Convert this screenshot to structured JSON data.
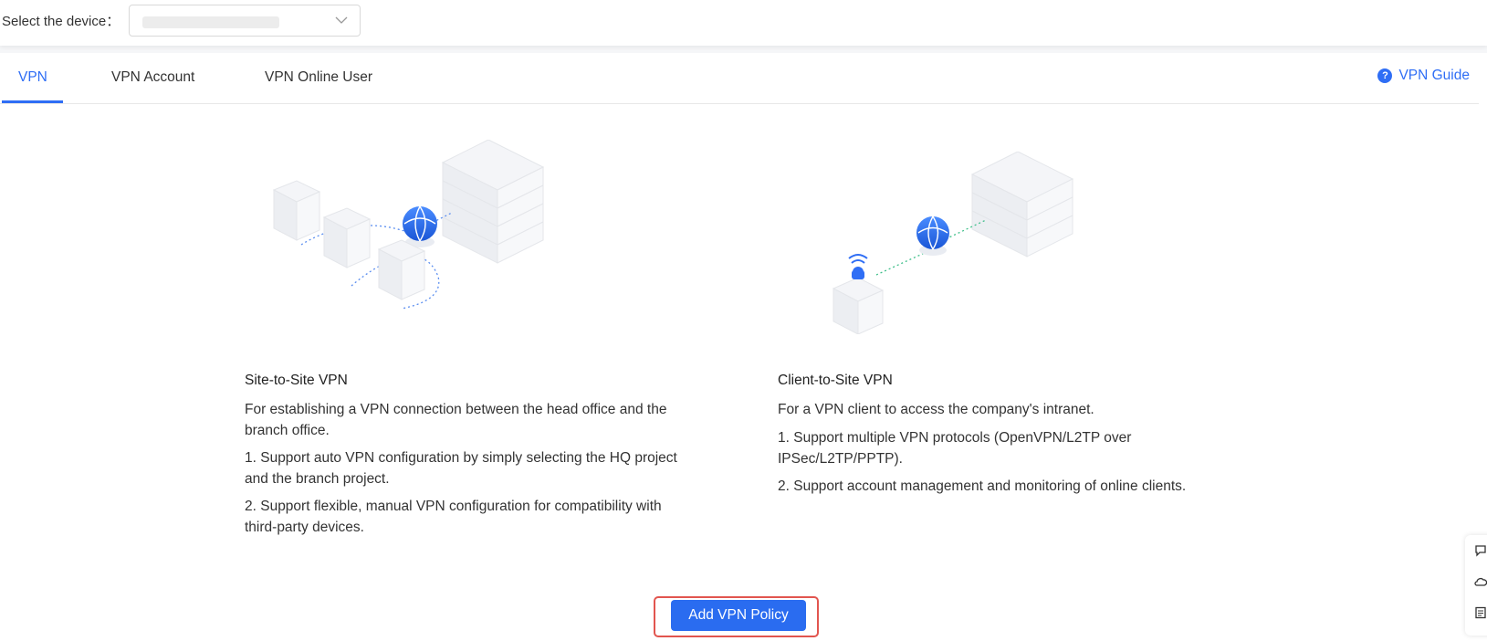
{
  "header": {
    "device_label": "Select the device：",
    "device_select": {
      "value": ""
    }
  },
  "tabs": [
    {
      "label": "VPN",
      "active": true
    },
    {
      "label": "VPN Account",
      "active": false
    },
    {
      "label": "VPN Online User",
      "active": false
    }
  ],
  "guide": {
    "label": "VPN Guide",
    "icon": "question-circle-icon"
  },
  "cards": {
    "site": {
      "title": "Site-to-Site VPN",
      "lines": [
        "For establishing a VPN connection between the head office and the branch office.",
        "1. Support auto VPN configuration by simply selecting the HQ project and the branch project.",
        "2. Support flexible, manual VPN configuration for compatibility with third-party devices."
      ]
    },
    "client": {
      "title": "Client-to-Site VPN",
      "lines": [
        "For a VPN client to access the company's intranet.",
        "1. Support multiple VPN protocols (OpenVPN/L2TP over IPSec/L2TP/PPTP).",
        "2. Support account management and monitoring of online clients."
      ]
    }
  },
  "actions": {
    "add_policy": "Add VPN Policy"
  },
  "colors": {
    "accent": "#2f6ef5",
    "button": "#2a6cf0",
    "highlight": "#e2554f"
  }
}
